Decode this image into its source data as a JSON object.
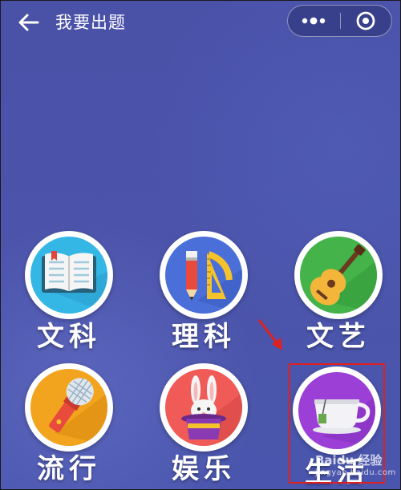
{
  "header": {
    "title": "我要出题",
    "back_icon": "back-arrow-icon",
    "more_icon": "more-dots-icon",
    "close_icon": "target-circle-icon"
  },
  "categories": [
    {
      "label": "文科",
      "icon": "open-book-icon",
      "color": "#35b7e6"
    },
    {
      "label": "理科",
      "icon": "pencil-ruler-icon",
      "color": "#4a6fd8"
    },
    {
      "label": "文艺",
      "icon": "guitar-icon",
      "color": "#43b34a"
    },
    {
      "label": "流行",
      "icon": "microphone-icon",
      "color": "#f2a41e"
    },
    {
      "label": "娱乐",
      "icon": "magic-hat-rabbit-icon",
      "color": "#f05b57"
    },
    {
      "label": "生活",
      "icon": "tea-cup-icon",
      "color": "#9c3fd6"
    }
  ],
  "annotation": {
    "arrow_color": "#e02020",
    "box_color": "#e02020"
  },
  "watermark": {
    "top": "Baidu 经验",
    "bottom": "jingyan.baidu.com"
  }
}
